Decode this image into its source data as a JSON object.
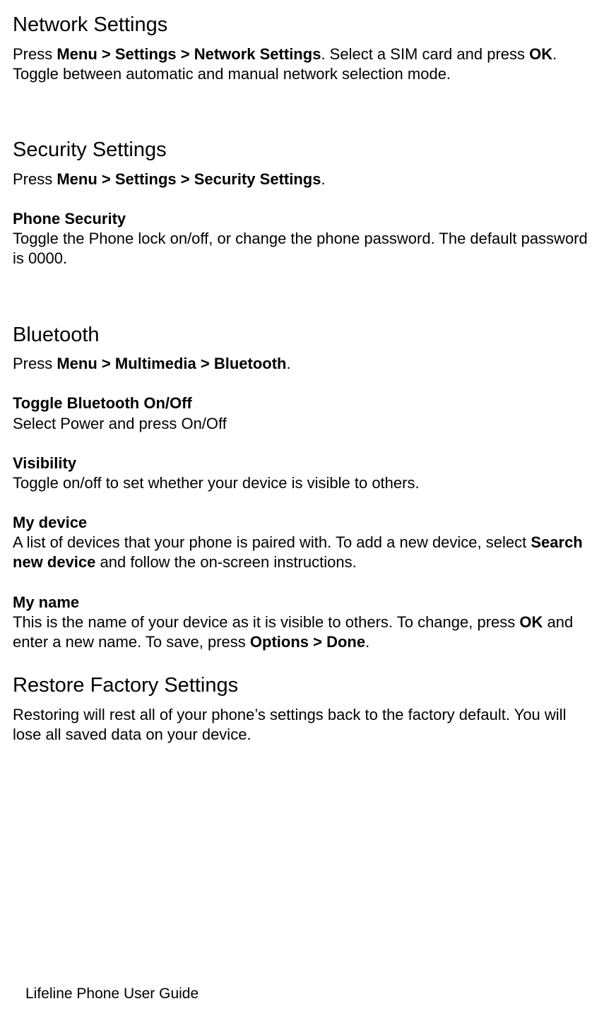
{
  "network": {
    "heading": "Network Settings",
    "body_pre": "Press ",
    "body_bold1": "Menu > Settings > Network Settings",
    "body_mid": ". Select a SIM card and press ",
    "body_bold2": "OK",
    "body_post": ". Toggle between automatic and manual network selection mode."
  },
  "security": {
    "heading": "Security Settings",
    "body_pre": "Press ",
    "body_bold": "Menu > Settings > Security Settings",
    "body_post": ".",
    "phone_heading": "Phone Security",
    "phone_body": "Toggle the Phone lock on/off, or change the phone password. The default password is 0000."
  },
  "bluetooth": {
    "heading": "Bluetooth",
    "body_pre": "Press ",
    "body_bold": "Menu > Multimedia > Bluetooth",
    "body_post": ".",
    "toggle_heading": "Toggle Bluetooth On/Off",
    "toggle_body": "Select Power and press On/Off",
    "vis_heading": "Visibility",
    "vis_body": "Toggle on/off to set whether your device is visible to others.",
    "device_heading": "My device",
    "device_body_pre": "A list of devices that your phone is paired with. To add a new device, select ",
    "device_body_bold": "Search new device",
    "device_body_post": " and follow the on-screen instructions.",
    "name_heading": "My name",
    "name_body_pre": "This is the name of your device as it is visible to others. To change, press ",
    "name_body_bold1": "OK",
    "name_body_mid": " and enter a new name. To save, press ",
    "name_body_bold2": "Options > Done",
    "name_body_post": "."
  },
  "restore": {
    "heading": "Restore Factory Settings",
    "body": "Restoring will rest all of your phone’s settings back to the factory default. You will lose all saved data on your device."
  },
  "footer": "Lifeline Phone User Guide"
}
